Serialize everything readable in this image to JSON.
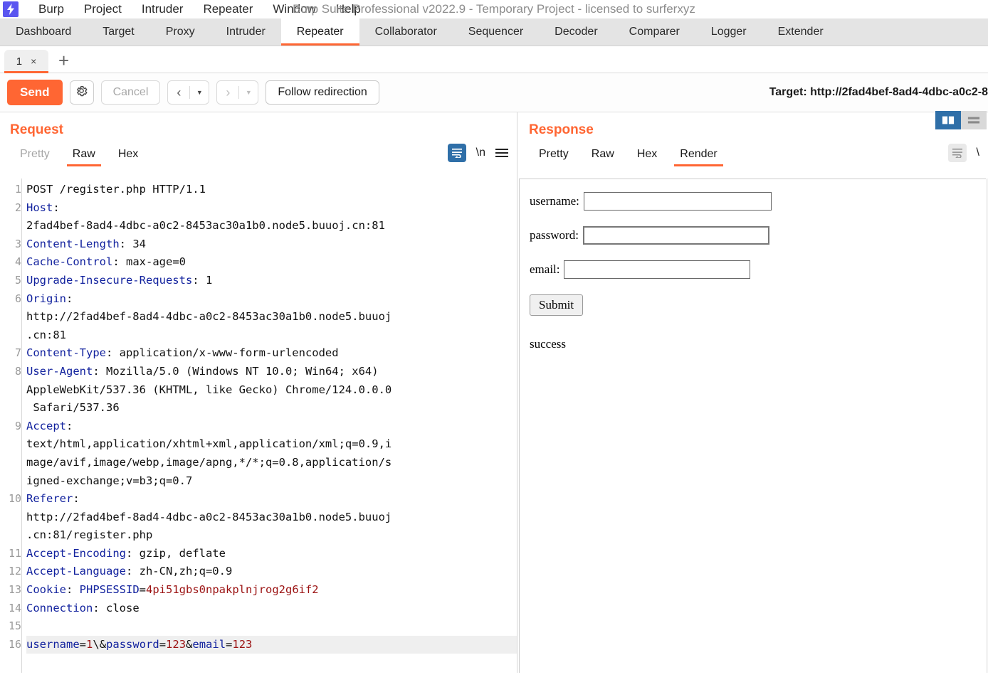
{
  "app": {
    "logo_icon": "burp-lightning-icon",
    "window_title": "Burp Suite Professional v2022.9 - Temporary Project - licensed to surferxyz"
  },
  "menubar": {
    "items": [
      {
        "label": "Burp"
      },
      {
        "label": "Project"
      },
      {
        "label": "Intruder"
      },
      {
        "label": "Repeater"
      },
      {
        "label": "Window"
      },
      {
        "label": "Help"
      }
    ]
  },
  "main_tabs": {
    "active": "Repeater",
    "items": [
      {
        "label": "Dashboard"
      },
      {
        "label": "Target"
      },
      {
        "label": "Proxy"
      },
      {
        "label": "Intruder"
      },
      {
        "label": "Repeater"
      },
      {
        "label": "Collaborator"
      },
      {
        "label": "Sequencer"
      },
      {
        "label": "Decoder"
      },
      {
        "label": "Comparer"
      },
      {
        "label": "Logger"
      },
      {
        "label": "Extender"
      }
    ]
  },
  "repeater_tabs": {
    "active_label": "1",
    "close_glyph": "×",
    "add_glyph": "+"
  },
  "toolbar": {
    "send_label": "Send",
    "settings_icon": "gear-icon",
    "cancel_label": "Cancel",
    "back_glyph": "‹",
    "forward_glyph": "›",
    "caret_glyph": "▼",
    "follow_redirection_label": "Follow redirection",
    "target_label": "Target: http://2fad4bef-8ad4-4dbc-a0c2-8"
  },
  "request": {
    "title": "Request",
    "tabs": [
      {
        "label": "Pretty",
        "active": false,
        "muted": true
      },
      {
        "label": "Raw",
        "active": true,
        "muted": false
      },
      {
        "label": "Hex",
        "active": false,
        "muted": false
      }
    ],
    "icons": [
      {
        "name": "word-wrap-icon",
        "selected": true
      },
      {
        "name": "newline-icon",
        "label": "\\n",
        "selected": false
      },
      {
        "name": "menu-icon",
        "selected": false
      }
    ],
    "lines": [
      {
        "num": "1",
        "segments": [
          {
            "t": "POST /register.php HTTP/1.1",
            "c": "val"
          }
        ]
      },
      {
        "num": "2",
        "segments": [
          {
            "t": "Host",
            "c": "hdr"
          },
          {
            "t": ":",
            "c": "val"
          }
        ]
      },
      {
        "num": "",
        "segments": [
          {
            "t": "2fad4bef-8ad4-4dbc-a0c2-8453ac30a1b0.node5.buuoj.cn:81",
            "c": "val"
          }
        ]
      },
      {
        "num": "3",
        "segments": [
          {
            "t": "Content-Length",
            "c": "hdr"
          },
          {
            "t": ": 34",
            "c": "val"
          }
        ]
      },
      {
        "num": "4",
        "segments": [
          {
            "t": "Cache-Control",
            "c": "hdr"
          },
          {
            "t": ": max-age=0",
            "c": "val"
          }
        ]
      },
      {
        "num": "5",
        "segments": [
          {
            "t": "Upgrade-Insecure-Requests",
            "c": "hdr"
          },
          {
            "t": ": 1",
            "c": "val"
          }
        ]
      },
      {
        "num": "6",
        "segments": [
          {
            "t": "Origin",
            "c": "hdr"
          },
          {
            "t": ":",
            "c": "val"
          }
        ]
      },
      {
        "num": "",
        "segments": [
          {
            "t": "http://2fad4bef-8ad4-4dbc-a0c2-8453ac30a1b0.node5.buuoj",
            "c": "val"
          }
        ]
      },
      {
        "num": "",
        "segments": [
          {
            "t": ".cn:81",
            "c": "val"
          }
        ]
      },
      {
        "num": "7",
        "segments": [
          {
            "t": "Content-Type",
            "c": "hdr"
          },
          {
            "t": ": application/x-www-form-urlencoded",
            "c": "val"
          }
        ]
      },
      {
        "num": "8",
        "segments": [
          {
            "t": "User-Agent",
            "c": "hdr"
          },
          {
            "t": ": Mozilla/5.0 (Windows NT 10.0; Win64; x64)",
            "c": "val"
          }
        ]
      },
      {
        "num": "",
        "segments": [
          {
            "t": "AppleWebKit/537.36 (KHTML, like Gecko) Chrome/124.0.0.0",
            "c": "val"
          }
        ]
      },
      {
        "num": "",
        "segments": [
          {
            "t": " Safari/537.36",
            "c": "val"
          }
        ]
      },
      {
        "num": "9",
        "segments": [
          {
            "t": "Accept",
            "c": "hdr"
          },
          {
            "t": ":",
            "c": "val"
          }
        ]
      },
      {
        "num": "",
        "segments": [
          {
            "t": "text/html,application/xhtml+xml,application/xml;q=0.9,i",
            "c": "val"
          }
        ]
      },
      {
        "num": "",
        "segments": [
          {
            "t": "mage/avif,image/webp,image/apng,*/*;q=0.8,application/s",
            "c": "val"
          }
        ]
      },
      {
        "num": "",
        "segments": [
          {
            "t": "igned-exchange;v=b3;q=0.7",
            "c": "val"
          }
        ]
      },
      {
        "num": "10",
        "segments": [
          {
            "t": "Referer",
            "c": "hdr"
          },
          {
            "t": ":",
            "c": "val"
          }
        ]
      },
      {
        "num": "",
        "segments": [
          {
            "t": "http://2fad4bef-8ad4-4dbc-a0c2-8453ac30a1b0.node5.buuoj",
            "c": "val"
          }
        ]
      },
      {
        "num": "",
        "segments": [
          {
            "t": ".cn:81/register.php",
            "c": "val"
          }
        ]
      },
      {
        "num": "11",
        "segments": [
          {
            "t": "Accept-Encoding",
            "c": "hdr"
          },
          {
            "t": ": gzip, deflate",
            "c": "val"
          }
        ]
      },
      {
        "num": "12",
        "segments": [
          {
            "t": "Accept-Language",
            "c": "hdr"
          },
          {
            "t": ": zh-CN,zh;q=0.9",
            "c": "val"
          }
        ]
      },
      {
        "num": "13",
        "segments": [
          {
            "t": "Cookie",
            "c": "hdr"
          },
          {
            "t": ": ",
            "c": "val"
          },
          {
            "t": "PHPSESSID",
            "c": "blue"
          },
          {
            "t": "=",
            "c": "val"
          },
          {
            "t": "4pi51gbs0npakplnjrog2g6if2",
            "c": "red"
          }
        ]
      },
      {
        "num": "14",
        "segments": [
          {
            "t": "Connection",
            "c": "hdr"
          },
          {
            "t": ": close",
            "c": "val"
          }
        ]
      },
      {
        "num": "15",
        "segments": [
          {
            "t": "",
            "c": "val"
          }
        ]
      },
      {
        "num": "16",
        "highlight": true,
        "segments": [
          {
            "t": "username",
            "c": "blue"
          },
          {
            "t": "=",
            "c": "val"
          },
          {
            "t": "1",
            "c": "red"
          },
          {
            "t": "\\",
            "c": "val"
          },
          {
            "t": "&",
            "c": "val"
          },
          {
            "t": "password",
            "c": "blue"
          },
          {
            "t": "=",
            "c": "val"
          },
          {
            "t": "123",
            "c": "red"
          },
          {
            "t": "&",
            "c": "val"
          },
          {
            "t": "email",
            "c": "blue"
          },
          {
            "t": "=",
            "c": "val"
          },
          {
            "t": "123",
            "c": "red"
          }
        ]
      }
    ]
  },
  "response": {
    "title": "Response",
    "tabs": [
      {
        "label": "Pretty",
        "active": false
      },
      {
        "label": "Raw",
        "active": false
      },
      {
        "label": "Hex",
        "active": false
      },
      {
        "label": "Render",
        "active": true
      }
    ],
    "view_toggles": [
      {
        "name": "split-vertical-icon",
        "selected": true
      },
      {
        "name": "split-horizontal-icon",
        "selected": false
      }
    ],
    "icons": [
      {
        "name": "word-wrap-icon",
        "selected": false
      },
      {
        "name": "newline-icon",
        "label": "\\",
        "selected": false
      }
    ],
    "rendered_page": {
      "fields": [
        {
          "label": "username:",
          "value": "",
          "name": "username"
        },
        {
          "label": "password:",
          "value": "",
          "name": "password"
        },
        {
          "label": "email:",
          "value": "",
          "name": "email"
        }
      ],
      "submit_label": "Submit",
      "message": "success"
    }
  },
  "colors": {
    "accent_orange": "#ff6633",
    "logo_purple": "#5b56f0",
    "selected_blue": "#2f6fa8",
    "header_blue": "#12229e",
    "value_red": "#9b1212"
  }
}
